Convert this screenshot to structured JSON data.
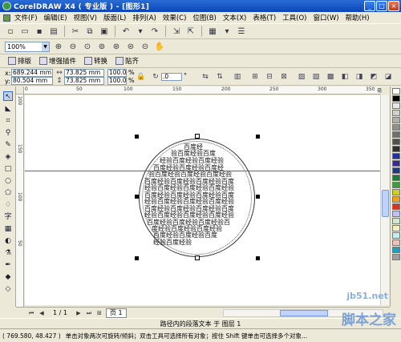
{
  "title": "CorelDRAW X4 ( 专业版 ) - [图形1]",
  "menu": [
    "文件(F)",
    "编辑(E)",
    "视图(V)",
    "版面(L)",
    "排列(A)",
    "效果(C)",
    "位图(B)",
    "文本(X)",
    "表格(T)",
    "工具(O)",
    "窗口(W)",
    "帮助(H)"
  ],
  "window_buttons": {
    "minimize": "_",
    "restore": "□",
    "close": "×"
  },
  "toolbar": {
    "zoom_value": "100%"
  },
  "plugins": {
    "arrange": "排版",
    "enhance": "增强插件",
    "convert": "转换",
    "paste": "贴齐"
  },
  "props": {
    "x_label": "x:",
    "y_label": "y:",
    "x_value": "689.244 mm",
    "y_value": "80.504 mm",
    "w_value": "73.825 mm",
    "h_value": "73.825 mm",
    "scale_x": "100.0",
    "scale_y": "100.0",
    "percent": "%",
    "rotation": ".0",
    "degree": "°"
  },
  "ruler": {
    "h_ticks": [
      "0",
      "50",
      "100",
      "150",
      "200",
      "250",
      "300",
      "350"
    ],
    "unit": "毫米",
    "v_ticks": [
      "200",
      "150",
      "100",
      "50"
    ]
  },
  "text_lines": [
    "百度经",
    "验百度经验百度",
    "经验百度经验百度经验",
    "百度经验百度经验百度经",
    "验百度经验百度经验百度经验",
    "百度经验百度经验百度经验百度",
    "经验百度经验百度经验百度经验",
    "百度经验百度经验百度经验百度",
    "经验百度经验百度经验百度经验",
    "百度经验百度经验百度经验百度",
    "经验百度经验百度经验百度经验",
    "百度经验百度经验百度经验百",
    "度经验百度经验百度经验",
    "百度经验百度经验百度",
    "经验百度经验"
  ],
  "pagebar": {
    "page_count": "1 / 1",
    "page_tab": "页 1"
  },
  "status": {
    "object_info": "路径内的段落文本 于 图层 1",
    "coords": "( 769.580, 48.427 )",
    "hint": "单击对象两次可旋转/倾斜；双击工具可选择所有对象；按住 Shift 键单击可选择多个对象..."
  },
  "watermark": {
    "site": "jb51.net",
    "brand": "脚本之家"
  },
  "colors": {
    "titlebar": "#0a45b8",
    "guide": "#e03030",
    "canvas": "#ffffff",
    "swatches": [
      "#ffffff",
      "#000000",
      "#e8e8e8",
      "#d0d0d0",
      "#b0b0b0",
      "#909090",
      "#707070",
      "#505050",
      "#303030",
      "#2030a0",
      "#3a2a90",
      "#203c80",
      "#1a7a3a",
      "#3aa03a",
      "#d0d020",
      "#f0a020",
      "#e03020",
      "#c0c0ff",
      "#d0e8d0",
      "#f0f0c0",
      "#c0f0f0",
      "#f0c0c0",
      "#20a0c0",
      "#a0a0a0"
    ]
  }
}
